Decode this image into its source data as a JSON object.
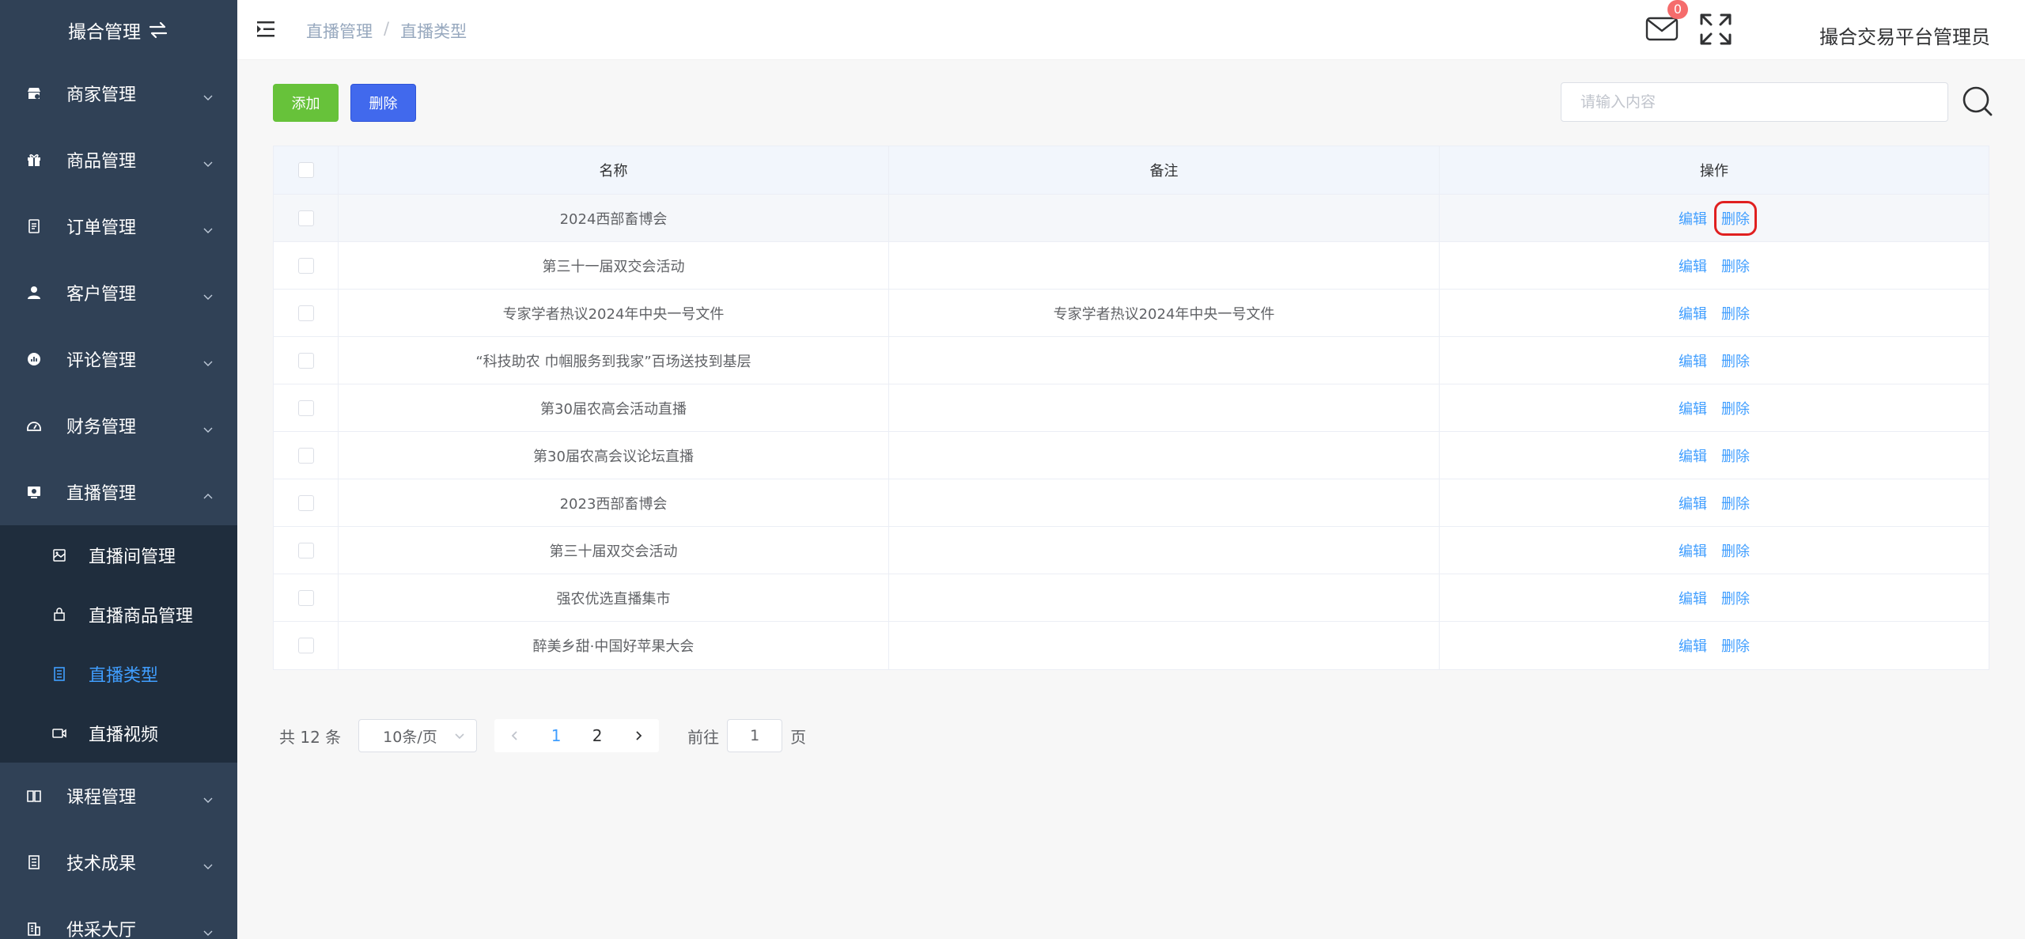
{
  "sidebar": {
    "title": "撮合管理",
    "items": [
      {
        "label": "商家管理",
        "icon": "store-icon"
      },
      {
        "label": "商品管理",
        "icon": "gift-icon"
      },
      {
        "label": "订单管理",
        "icon": "document-icon"
      },
      {
        "label": "客户管理",
        "icon": "user-icon"
      },
      {
        "label": "评论管理",
        "icon": "comment-icon"
      },
      {
        "label": "财务管理",
        "icon": "wallet-icon"
      },
      {
        "label": "直播管理",
        "icon": "live-icon"
      }
    ],
    "sub_items": [
      {
        "label": "直播间管理",
        "icon": "image-icon"
      },
      {
        "label": "直播商品管理",
        "icon": "bag-icon"
      },
      {
        "label": "直播类型",
        "icon": "list-icon",
        "active": true
      },
      {
        "label": "直播视频",
        "icon": "video-icon"
      }
    ],
    "items_after": [
      {
        "label": "课程管理",
        "icon": "book-icon"
      },
      {
        "label": "技术成果",
        "icon": "notebook-icon"
      },
      {
        "label": "供采大厅",
        "icon": "building-icon"
      }
    ]
  },
  "header": {
    "breadcrumb": [
      "直播管理",
      "直播类型"
    ],
    "breadcrumb_sep": "/",
    "mail_count": "0",
    "username": "撮合交易平台管理员"
  },
  "toolbar": {
    "add_label": "添加",
    "delete_label": "删除",
    "search_placeholder": "请输入内容"
  },
  "table": {
    "columns": [
      "名称",
      "备注",
      "操作"
    ],
    "edit_label": "编辑",
    "delete_label": "删除",
    "rows": [
      {
        "name": "2024西部畜博会",
        "remark": ""
      },
      {
        "name": "第三十一届双交会活动",
        "remark": ""
      },
      {
        "name": "专家学者热议2024年中央一号文件",
        "remark": "专家学者热议2024年中央一号文件"
      },
      {
        "name": "“科技助农 巾帼服务到我家”百场送技到基层",
        "remark": ""
      },
      {
        "name": "第30届农高会活动直播",
        "remark": ""
      },
      {
        "name": "第30届农高会议论坛直播",
        "remark": ""
      },
      {
        "name": "2023西部畜博会",
        "remark": ""
      },
      {
        "name": "第三十届双交会活动",
        "remark": ""
      },
      {
        "name": "强农优选直播集市",
        "remark": ""
      },
      {
        "name": "醉美乡甜·中国好苹果大会",
        "remark": ""
      }
    ]
  },
  "pagination": {
    "total_text": "共 12 条",
    "page_size": "10条/页",
    "pages": [
      "1",
      "2"
    ],
    "current": "1",
    "goto_prefix": "前往",
    "goto_value": "1",
    "goto_suffix": "页"
  },
  "colors": {
    "sidebar_bg": "#304156",
    "submenu_bg": "#1f2d3d",
    "accent": "#409eff",
    "add_button": "#67c23a",
    "delete_button": "#4169ed",
    "highlight_box": "#e02020",
    "badge": "#f56c6c"
  }
}
